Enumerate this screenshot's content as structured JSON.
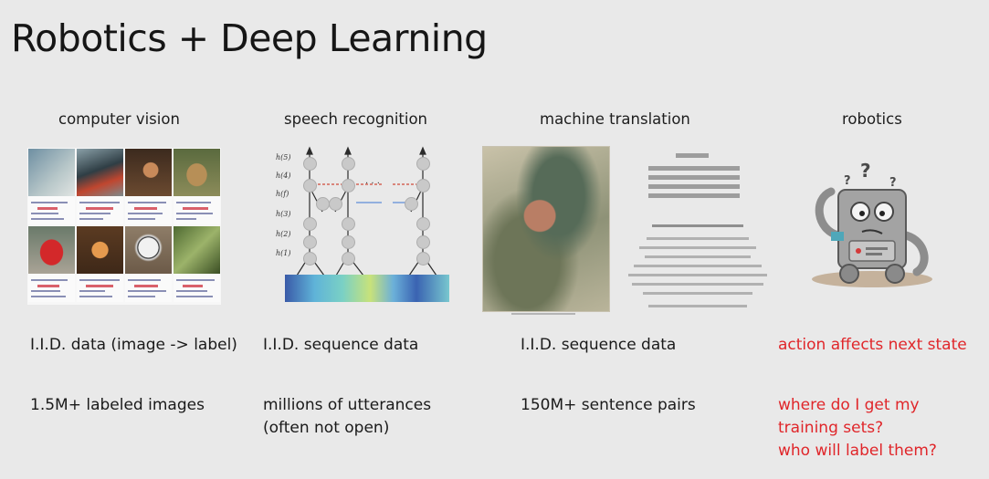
{
  "slide": {
    "title": "Robotics + Deep Learning",
    "columns": [
      {
        "heading": "computer vision",
        "data_line": "I.I.D. data (image -> label)",
        "dataset_lines": [
          "1.5M+ labeled images"
        ]
      },
      {
        "heading": "speech recognition",
        "data_line": "I.I.D. sequence data",
        "dataset_lines": [
          "millions of utterances",
          "(often not open)"
        ]
      },
      {
        "heading": "machine translation",
        "data_line": "I.I.D. sequence data",
        "dataset_lines": [
          "150M+ sentence pairs"
        ]
      },
      {
        "heading": "robotics",
        "data_line": "action affects next state",
        "dataset_lines": [
          "where do I get my",
          "training sets?",
          "who will label them?"
        ]
      }
    ],
    "colors": {
      "background": "#e9e9e9",
      "text": "#1b1b1b",
      "highlight_red": "#e0262a"
    }
  }
}
